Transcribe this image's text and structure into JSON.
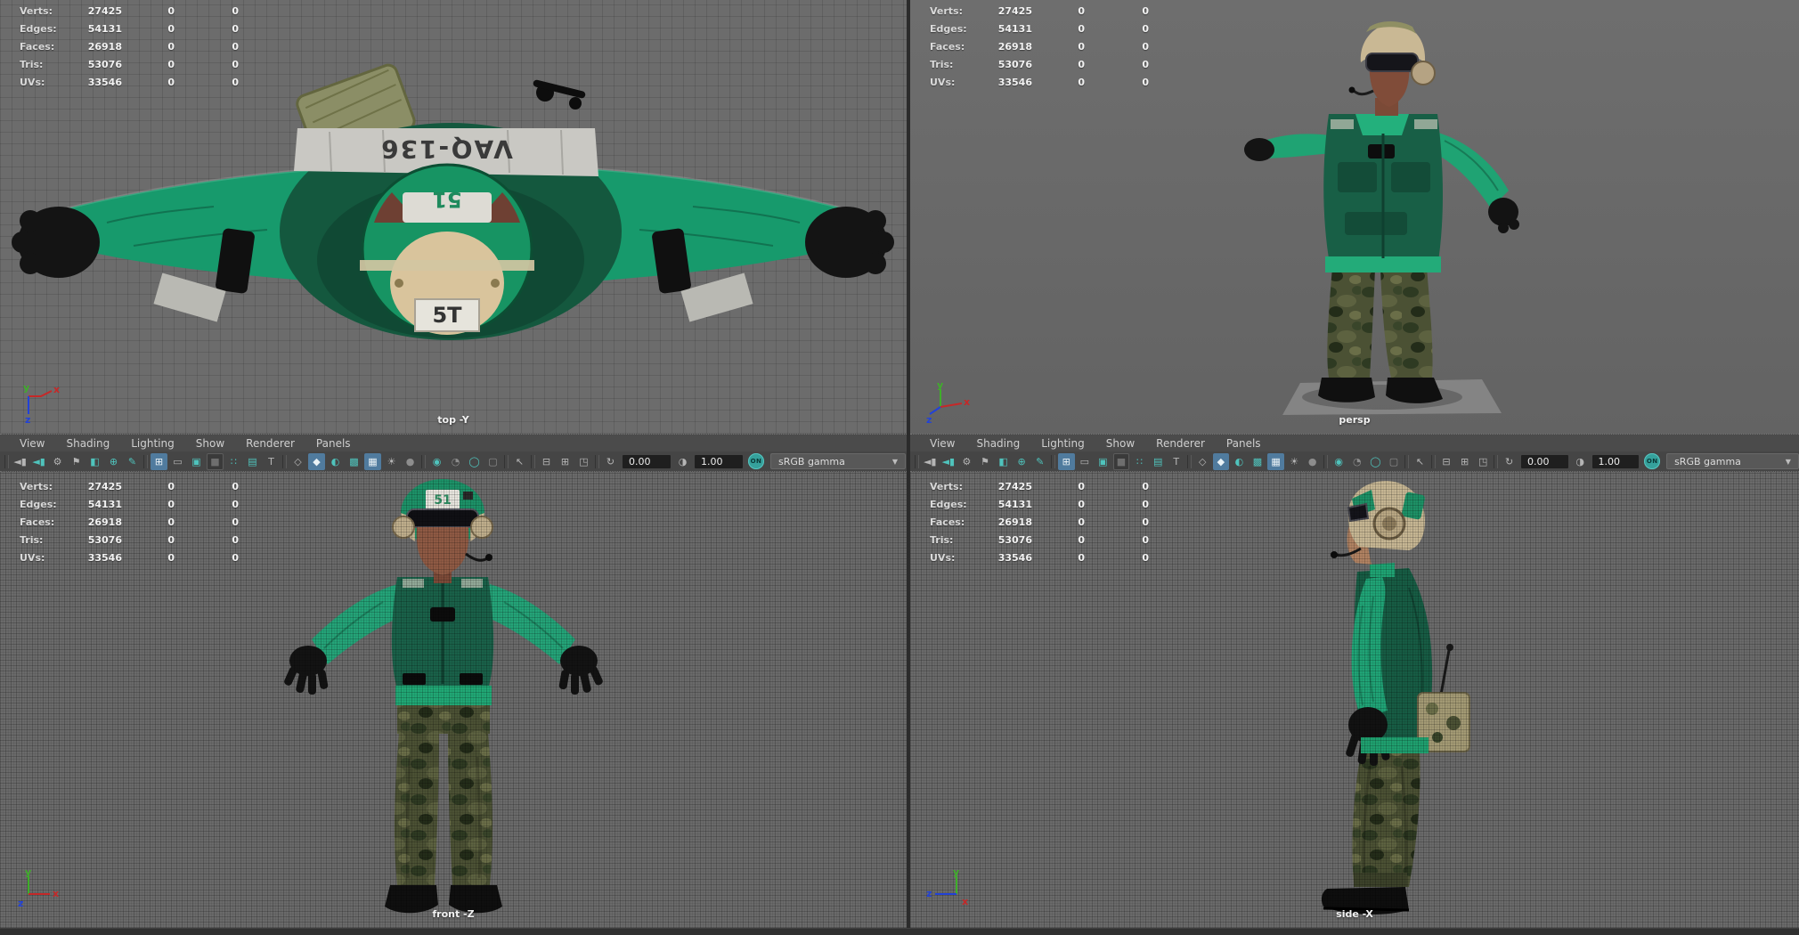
{
  "colors": {
    "accent_teal": "#4fc3bc",
    "active_blue": "#507b9e",
    "panel_gray": "#454545",
    "viewport_gray": "#6a6a6a",
    "vest_green": "#1a6149",
    "shirt_green": "#1fa373",
    "helmet_tan": "#c9b894"
  },
  "stats": {
    "rows": [
      {
        "label": "Verts:",
        "value": "27425",
        "sel": "0",
        "other": "0"
      },
      {
        "label": "Edges:",
        "value": "54131",
        "sel": "0",
        "other": "0"
      },
      {
        "label": "Faces:",
        "value": "26918",
        "sel": "0",
        "other": "0"
      },
      {
        "label": "Tris:",
        "value": "53076",
        "sel": "0",
        "other": "0"
      },
      {
        "label": "UVs:",
        "value": "33546",
        "sel": "0",
        "other": "0"
      }
    ]
  },
  "menu_items": [
    "View",
    "Shading",
    "Lighting",
    "Show",
    "Renderer",
    "Panels"
  ],
  "toolbar": {
    "exposure_value": "0.00",
    "gamma_value": "1.00",
    "on_label": "ON",
    "view_transform": "sRGB gamma",
    "icons": [
      {
        "sep": true
      },
      {
        "name": "select-camera",
        "glyph": "◄▮",
        "tone": "gray"
      },
      {
        "name": "lock-camera",
        "glyph": "◄▮",
        "tone": "teal"
      },
      {
        "name": "camera-attributes",
        "glyph": "⚙",
        "tone": "gray"
      },
      {
        "name": "bookmark-view",
        "glyph": "⚑",
        "tone": "gray"
      },
      {
        "name": "image-plane",
        "glyph": "◧",
        "tone": "teal"
      },
      {
        "name": "pan-zoom-2d",
        "glyph": "⊕",
        "tone": "teal"
      },
      {
        "name": "grease-pencil",
        "glyph": "✎",
        "tone": "teal"
      },
      {
        "sep": true
      },
      {
        "name": "grid-display",
        "glyph": "⊞",
        "tone": "light",
        "active": true
      },
      {
        "name": "film-gate",
        "glyph": "▭",
        "tone": "gray"
      },
      {
        "name": "resolution-gate",
        "glyph": "▣",
        "tone": "teal"
      },
      {
        "name": "gate-mask",
        "glyph": "■",
        "tone": "dark"
      },
      {
        "name": "field-chart",
        "glyph": "∷",
        "tone": "teal"
      },
      {
        "name": "safe-action",
        "glyph": "▤",
        "tone": "teal"
      },
      {
        "name": "safe-title",
        "glyph": "T",
        "tone": "gray"
      },
      {
        "sep": true
      },
      {
        "name": "wireframe-display",
        "glyph": "◇",
        "tone": "gray"
      },
      {
        "name": "smooth-shade-all",
        "glyph": "◆",
        "tone": "teal",
        "active": true
      },
      {
        "name": "flat-shade-all",
        "glyph": "◐",
        "tone": "teal"
      },
      {
        "name": "textured-display",
        "glyph": "▩",
        "tone": "teal"
      },
      {
        "name": "use-default-material",
        "glyph": "▦",
        "tone": "light",
        "active": true
      },
      {
        "name": "lights-display",
        "glyph": "☀",
        "tone": "gray"
      },
      {
        "name": "shadows-display",
        "glyph": "●",
        "tone": "muted"
      },
      {
        "sep": true
      },
      {
        "name": "ssao",
        "glyph": "◉",
        "tone": "teal"
      },
      {
        "name": "motion-blur",
        "glyph": "◔",
        "tone": "muted"
      },
      {
        "name": "anti-aliasing",
        "glyph": "◯",
        "tone": "teal"
      },
      {
        "name": "render-region",
        "glyph": "▢",
        "tone": "muted"
      },
      {
        "sep": true
      },
      {
        "name": "object-selection",
        "glyph": "↖",
        "tone": "gray"
      },
      {
        "sep": true
      },
      {
        "name": "layer-overlay",
        "glyph": "⊟",
        "tone": "gray"
      },
      {
        "name": "layer-stack",
        "glyph": "⊞",
        "tone": "gray"
      },
      {
        "name": "screen-capture",
        "glyph": "◳",
        "tone": "gray"
      },
      {
        "sep": true
      },
      {
        "name": "exposure",
        "glyph": "↻",
        "tone": "gray",
        "field": "exposure_value"
      },
      {
        "name": "gamma",
        "glyph": "◑",
        "tone": "gray",
        "field": "gamma_value"
      },
      {
        "name": "color-managed",
        "badge": true
      },
      {
        "name": "view-transform",
        "dropdown": true
      }
    ]
  },
  "viewports": [
    {
      "id": "top",
      "label": "top -Y"
    },
    {
      "id": "persp",
      "label": "persp"
    },
    {
      "id": "front",
      "label": "front -Z"
    },
    {
      "id": "side",
      "label": "side -X"
    }
  ],
  "axis_labels": {
    "x": "x",
    "y": "y",
    "z": "z"
  },
  "model": {
    "banner_text": "VAQ-136",
    "helmet_patch_text": "5T",
    "helmet_band_text": "51"
  }
}
